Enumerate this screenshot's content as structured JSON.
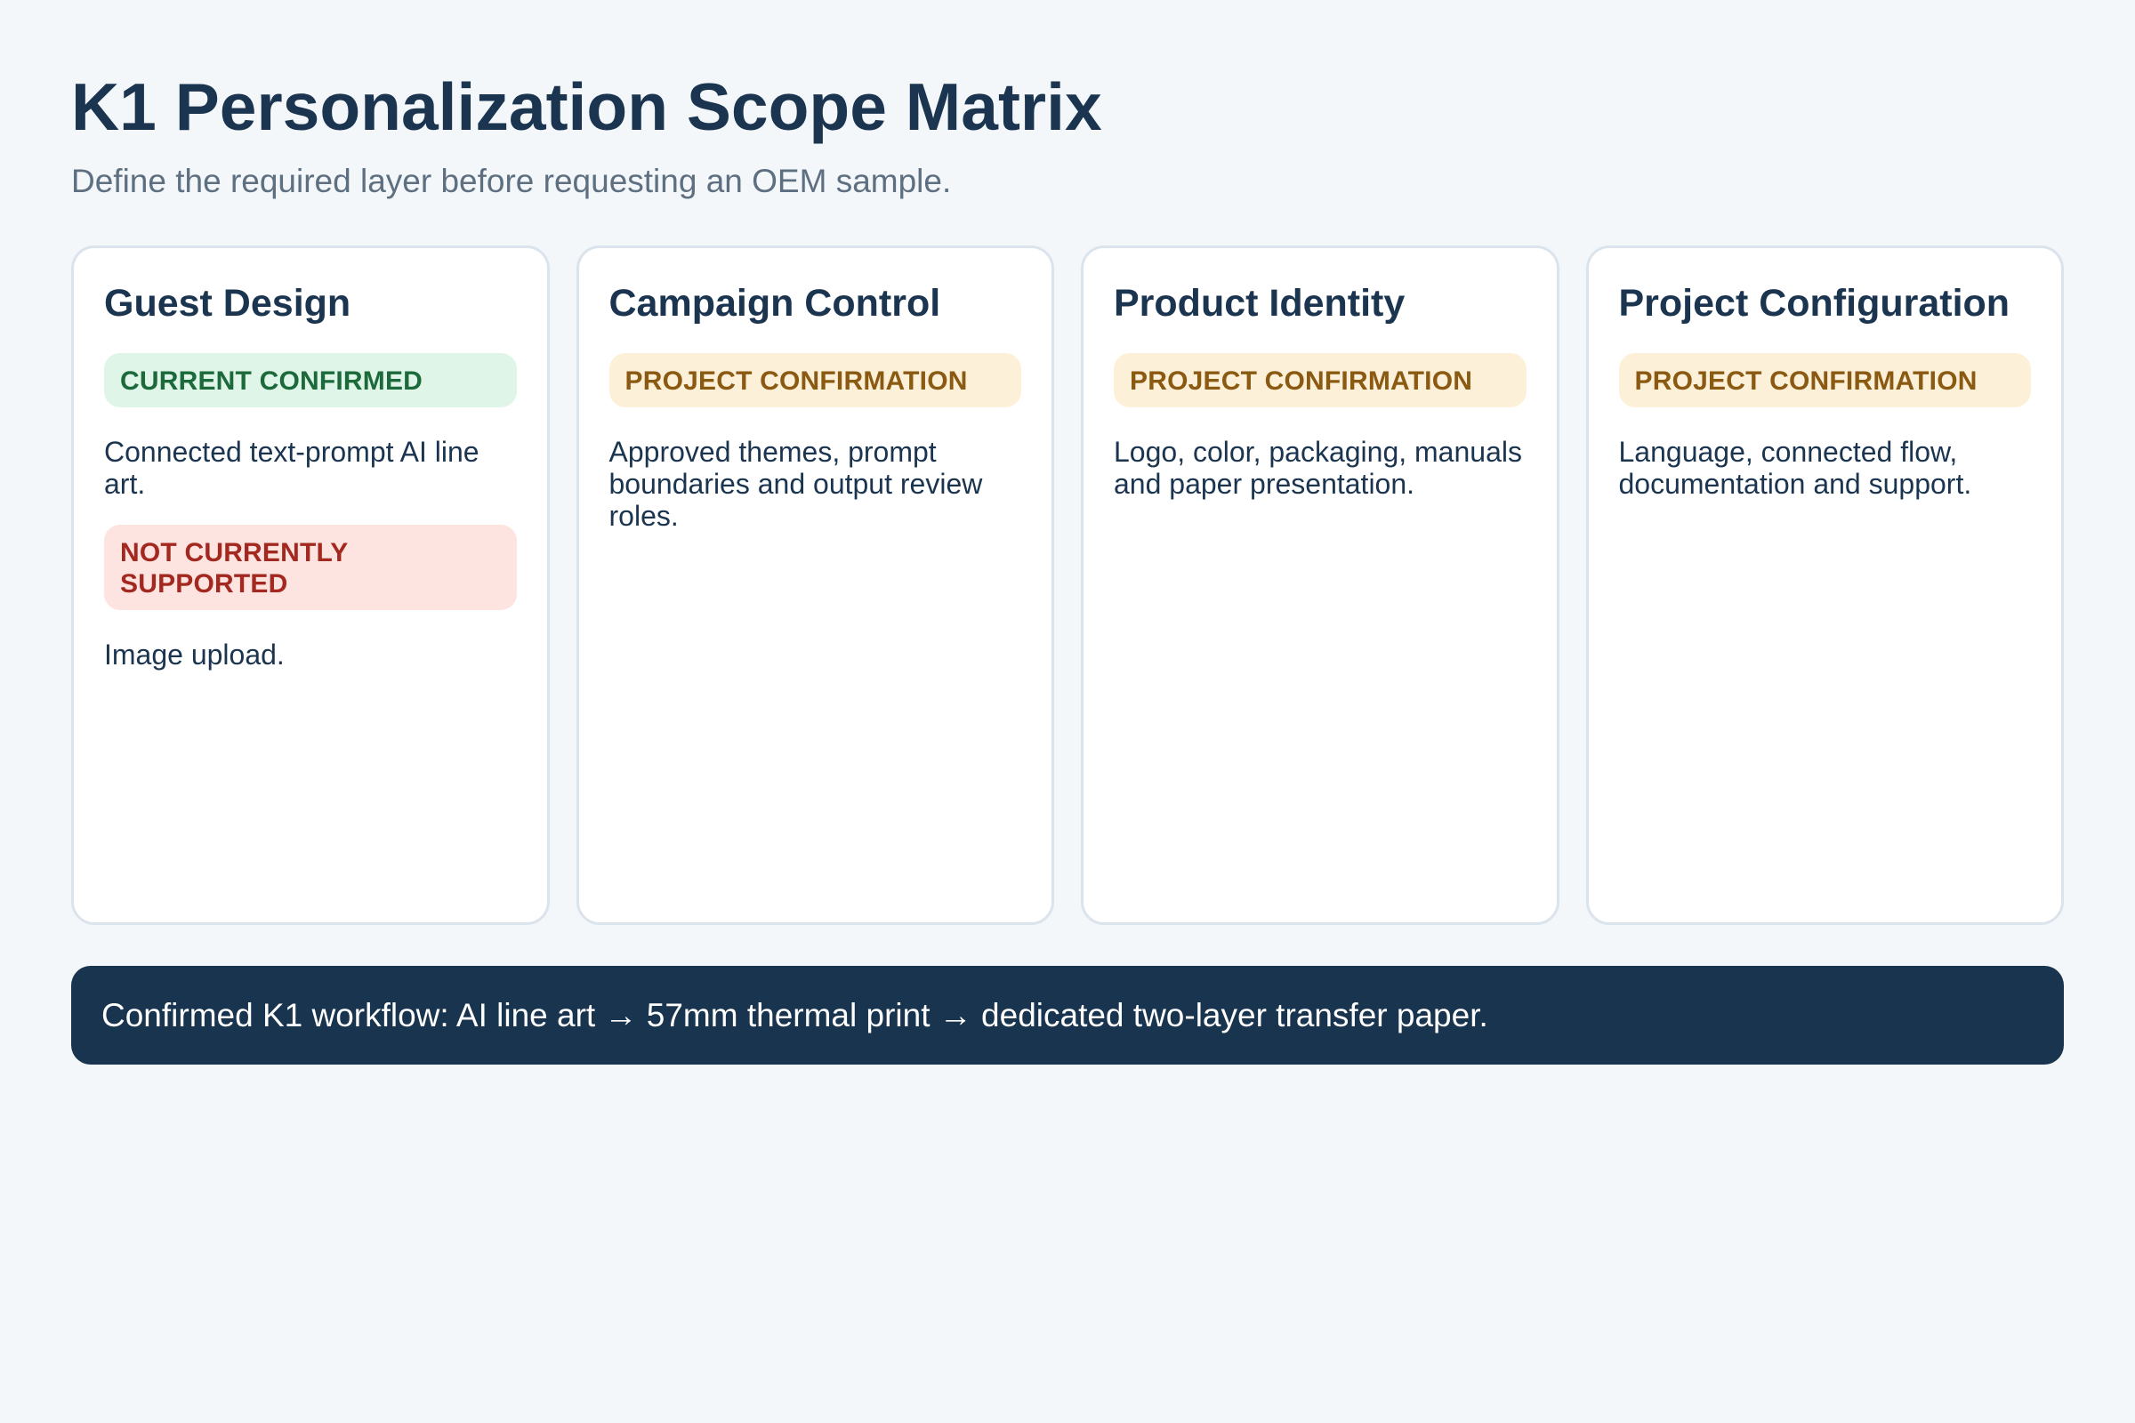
{
  "page": {
    "title": "K1 Personalization Scope Matrix",
    "subtitle": "Define the required layer before requesting an OEM sample."
  },
  "cards": [
    {
      "title": "Guest Design",
      "statuses": [
        {
          "label": "CURRENT CONFIRMED",
          "tone": "green",
          "color": "#1c6a3b",
          "background": "#dff5e7",
          "text": "Connected text-prompt AI line art."
        },
        {
          "label": "NOT CURRENTLY SUPPORTED",
          "tone": "red",
          "color": "#a3281f",
          "background": "#fde4e1",
          "text": "Image upload."
        }
      ]
    },
    {
      "title": "Campaign Control",
      "statuses": [
        {
          "label": "PROJECT CONFIRMATION",
          "tone": "amber",
          "color": "#8a5a12",
          "background": "#fdf0d8",
          "text": "Approved themes, prompt boundaries and output review roles."
        }
      ]
    },
    {
      "title": "Product Identity",
      "statuses": [
        {
          "label": "PROJECT CONFIRMATION",
          "tone": "amber",
          "color": "#8a5a12",
          "background": "#fdf0d8",
          "text": "Logo, color, packaging, manuals and paper presentation."
        }
      ]
    },
    {
      "title": "Project Configuration",
      "statuses": [
        {
          "label": "PROJECT CONFIRMATION",
          "tone": "amber",
          "color": "#8a5a12",
          "background": "#fdf0d8",
          "text": "Language, connected flow, documentation and support."
        }
      ]
    }
  ],
  "banner": {
    "text": "Confirmed K1 workflow: AI line art → 57mm thermal print → dedicated two-layer transfer paper.",
    "background": "#18344f"
  }
}
